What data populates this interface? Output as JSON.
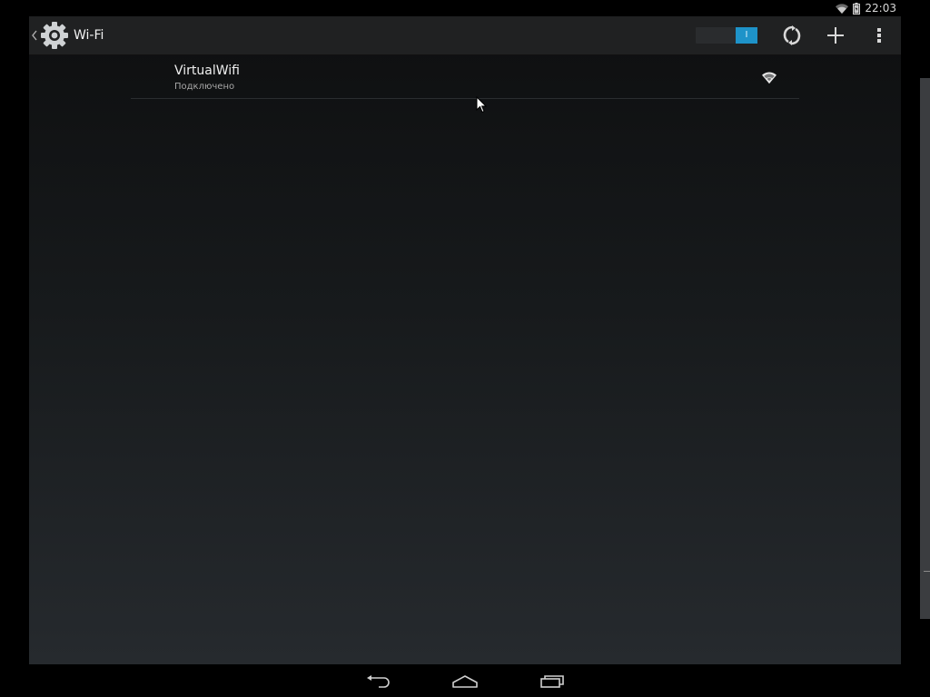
{
  "status_bar": {
    "time": "22:03",
    "icons": [
      "wifi-signal-icon",
      "battery-icon"
    ]
  },
  "action_bar": {
    "title": "Wi-Fi",
    "app_icon": "settings-gear-icon",
    "wifi_toggle": {
      "state": "on",
      "thumb_label": "I"
    },
    "actions": [
      "wps-icon",
      "add-network-icon",
      "overflow-menu-icon"
    ]
  },
  "networks": [
    {
      "name": "VirtualWifi",
      "status": "Подключено",
      "signal_icon": "wifi-signal-full-icon"
    }
  ],
  "nav_bar": {
    "buttons": [
      "back-icon",
      "home-icon",
      "recent-apps-icon"
    ]
  },
  "colors": {
    "accent": "#1e93c9",
    "action_bar_bg": "#202122",
    "content_bg_top": "#0e0f10",
    "content_bg_bottom": "#262a2e"
  }
}
